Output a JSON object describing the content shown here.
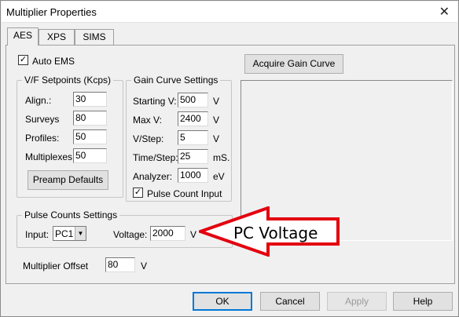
{
  "window": {
    "title": "Multiplier Properties",
    "close_glyph": "✕"
  },
  "tabs": [
    {
      "label": "AES",
      "active": true
    },
    {
      "label": "XPS",
      "active": false
    },
    {
      "label": "SIMS",
      "active": false
    }
  ],
  "auto_ems": {
    "label": "Auto EMS",
    "checked": true
  },
  "vf_setpoints": {
    "title": "V/F Setpoints (Kcps)",
    "fields": [
      {
        "label": "Align.:",
        "value": "30"
      },
      {
        "label": "Surveys",
        "value": "80"
      },
      {
        "label": "Profiles:",
        "value": "50"
      },
      {
        "label": "Multiplexes:",
        "value": "50"
      }
    ],
    "preamp_button": "Preamp Defaults"
  },
  "gain_curve": {
    "title": "Gain Curve Settings",
    "fields": [
      {
        "label": "Starting V:",
        "value": "500",
        "unit": "V"
      },
      {
        "label": "Max V:",
        "value": "2400",
        "unit": "V"
      },
      {
        "label": "V/Step:",
        "value": "5",
        "unit": "V"
      },
      {
        "label": "Time/Step:",
        "value": "25",
        "unit": "mS."
      },
      {
        "label": "Analyzer:",
        "value": "1000",
        "unit": "eV"
      }
    ],
    "pulse_count_input": {
      "label": "Pulse Count Input",
      "checked": true
    }
  },
  "acquire_button": "Acquire Gain Curve",
  "pulse_counts": {
    "title": "Pulse Counts Settings",
    "input_label": "Input:",
    "input_value": "PC1",
    "voltage_label": "Voltage:",
    "voltage_value": "2000",
    "voltage_unit": "V"
  },
  "multiplier_offset": {
    "label": "Multiplier Offset",
    "value": "80",
    "unit": "V"
  },
  "buttons": {
    "ok": "OK",
    "cancel": "Cancel",
    "apply": "Apply",
    "help": "Help"
  },
  "annotation": {
    "text": "PC Voltage",
    "arrow_color": "#e3000f"
  },
  "check_glyph": "✓",
  "dropdown_glyph": "▼"
}
